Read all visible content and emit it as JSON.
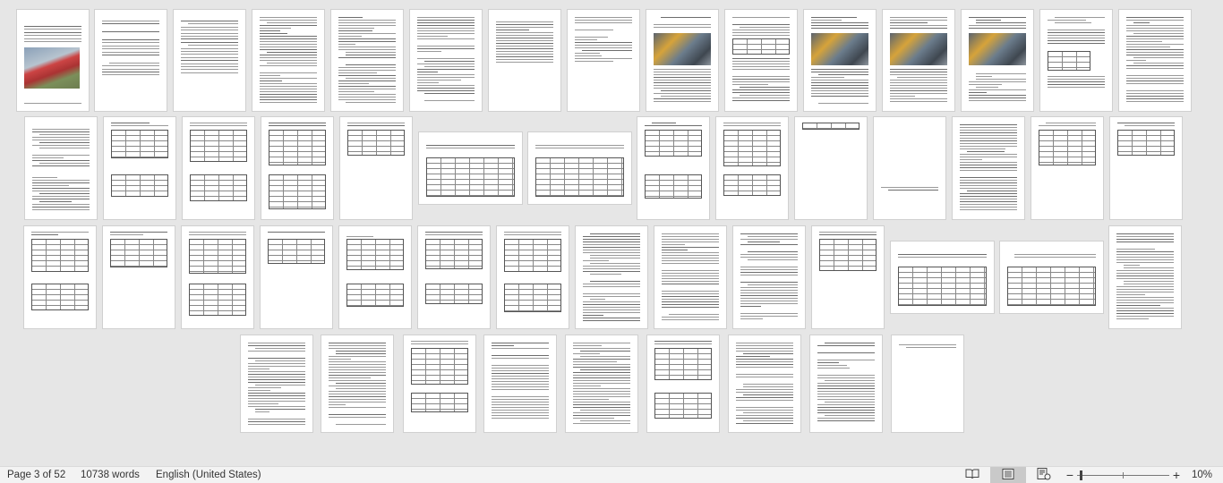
{
  "document": {
    "total_pages": 52,
    "rows": [
      [
        "text-photo",
        "toc",
        "toc",
        "text",
        "text",
        "text",
        "text-short",
        "text-short",
        "photo-text",
        "table-text",
        "photo-text",
        "photo-text",
        "photo-text",
        "text-table",
        "text"
      ],
      [
        "text",
        "table",
        "table",
        "table",
        "table",
        "landscape-table",
        "landscape-table",
        "table",
        "table",
        "table-small",
        "section-title",
        "text",
        "table",
        "table"
      ],
      [
        "table",
        "table",
        "table",
        "table",
        "table",
        "table",
        "table",
        "text",
        "text",
        "text",
        "table",
        "landscape-table",
        "landscape-table",
        "text"
      ],
      [
        "text",
        "text",
        "table",
        "text",
        "text",
        "table",
        "text",
        "text",
        "end"
      ]
    ]
  },
  "statusbar": {
    "page_indicator": "Page 3 of 52",
    "word_count": "10738 words",
    "language": "English (United States)",
    "zoom_level": "10%",
    "zoom_minus": "−",
    "zoom_plus": "+"
  }
}
